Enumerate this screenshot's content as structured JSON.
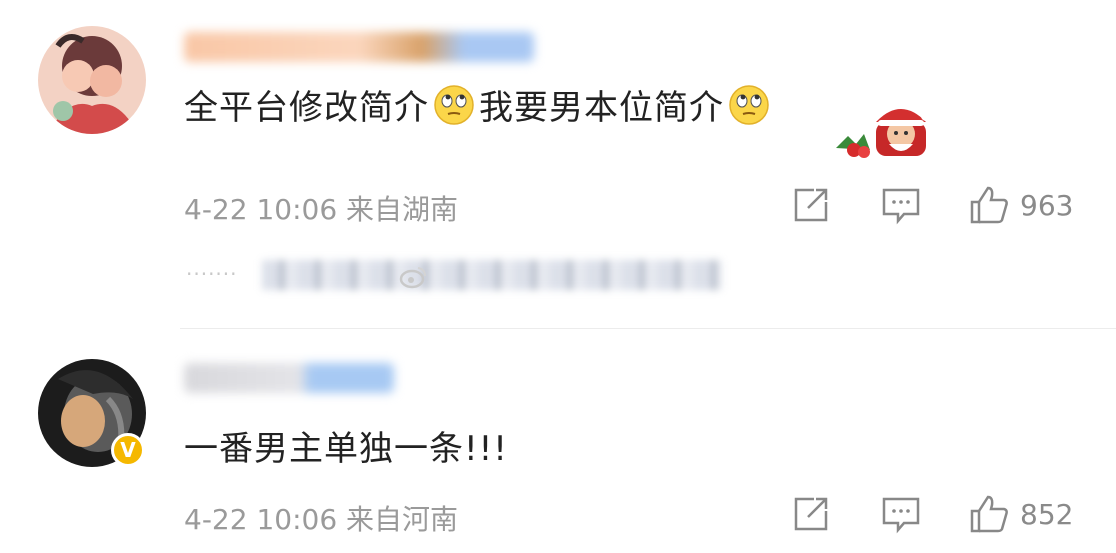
{
  "comments": [
    {
      "text_part1": "全平台修改简介",
      "text_part2": "我要男本位简介",
      "emoji_1": "eye-roll-emoji",
      "emoji_2": "eye-roll-emoji",
      "sticker": "christmas-sticker",
      "time": "4-22 10:06",
      "location": "来自湖南",
      "likes": "963",
      "verified": false
    },
    {
      "text": "一番男主单独一条!!!",
      "time": "4-22 10:06",
      "location": "来自河南",
      "likes": "852",
      "verified": true,
      "verify_glyph": "V"
    }
  ],
  "icons": {
    "share": "share-icon",
    "reply": "comment-icon",
    "like": "thumbs-up-icon"
  },
  "colors": {
    "text": "#222222",
    "meta": "#9a9a9a",
    "verify_badge": "#f5b800",
    "divider": "#ececec"
  }
}
